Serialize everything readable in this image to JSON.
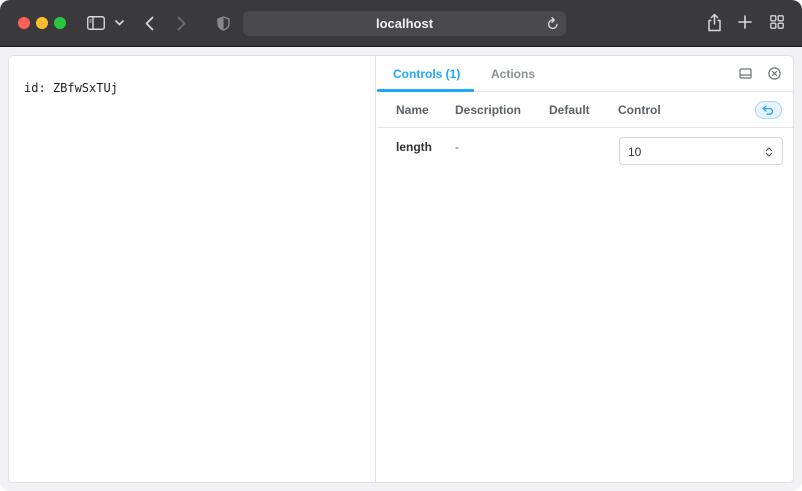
{
  "browser": {
    "address": "localhost",
    "icons": {
      "sidebar": "sidebar-icon",
      "chevron": "chevron-down-icon",
      "back": "back-arrow-icon",
      "forward": "forward-arrow-icon",
      "shield": "shield-icon",
      "reload": "reload-icon",
      "share": "share-icon",
      "newtab": "plus-icon",
      "tabs": "tab-overview-icon"
    },
    "colors": {
      "toolbar": "#3a3a3c",
      "accent": "#1ea7fd"
    }
  },
  "preview": {
    "text": "id: ZBfwSxTUj"
  },
  "addons": {
    "tabs": [
      {
        "label": "Controls (1)",
        "active": true
      },
      {
        "label": "Actions",
        "active": false
      }
    ],
    "columns": {
      "name": "Name",
      "description": "Description",
      "default": "Default",
      "control": "Control"
    },
    "rows": [
      {
        "name": "length",
        "description": "-",
        "default": "",
        "value": "10"
      }
    ]
  }
}
